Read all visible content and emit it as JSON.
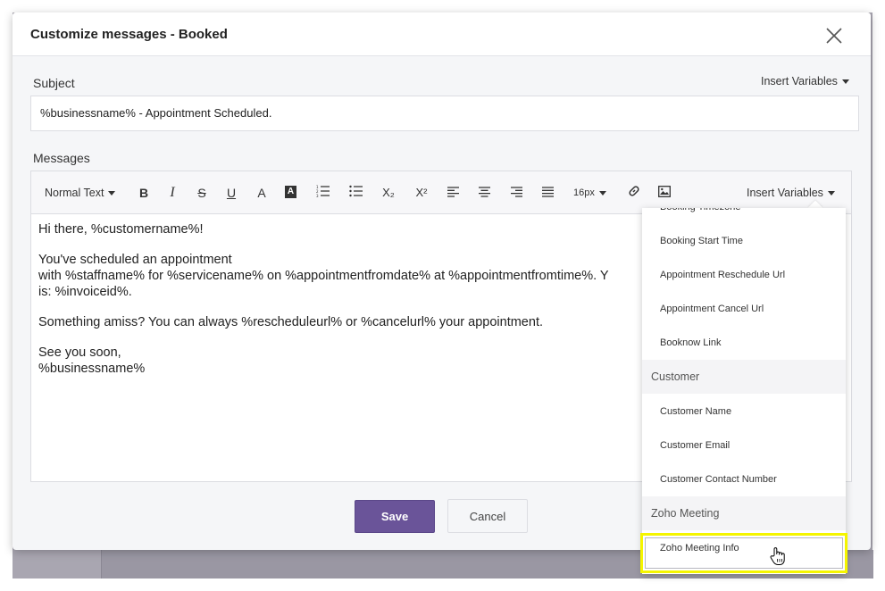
{
  "modal": {
    "title": "Customize messages - Booked",
    "close_icon": "close-icon"
  },
  "subject": {
    "label": "Subject",
    "insert_variables": "Insert Variables",
    "value": "%businessname% - Appointment Scheduled."
  },
  "messages": {
    "label": "Messages",
    "toolbar": {
      "format": "Normal Text",
      "bold": "B",
      "italic": "I",
      "strike": "S",
      "underline": "U",
      "font_color": "A",
      "bg_color": "A",
      "subscript": "X₂",
      "superscript": "X²",
      "font_size": "16px",
      "insert_variables": "Insert Variables",
      "icons": [
        "bold-icon",
        "italic-icon",
        "strikethrough-icon",
        "underline-icon",
        "font-color-icon",
        "highlight-icon",
        "ordered-list-icon",
        "unordered-list-icon",
        "subscript-icon",
        "superscript-icon",
        "align-left-icon",
        "align-center-icon",
        "align-right-icon",
        "justify-icon",
        "link-icon",
        "image-icon"
      ]
    },
    "body": {
      "line1": "Hi there, %customername%!",
      "line2": "You've scheduled an appointment\nwith %staffname% for %servicename% on %appointmentfromdate% at %appointmentfromtime%. Y\nis: %invoiceid%.",
      "line3": "Something amiss? You can always %rescheduleurl% or %cancelurl% your appointment.",
      "line4": "See you soon,\n%businessname%"
    }
  },
  "actions": {
    "save": "Save",
    "cancel": "Cancel"
  },
  "dropdown": {
    "items": [
      {
        "label": "Booking Timezone"
      },
      {
        "label": "Booking Start Time"
      },
      {
        "label": "Appointment Reschedule Url"
      },
      {
        "label": "Appointment Cancel Url"
      },
      {
        "label": "Booknow Link"
      }
    ],
    "group_customer": "Customer",
    "customer_items": [
      {
        "label": "Customer Name"
      },
      {
        "label": "Customer Email"
      },
      {
        "label": "Customer Contact Number"
      }
    ],
    "group_zoho": "Zoho Meeting",
    "zoho_item": "Zoho Meeting Info"
  },
  "colors": {
    "accent": "#6a5499",
    "highlight": "#f5f500",
    "backdrop": "#a9a6b1"
  }
}
